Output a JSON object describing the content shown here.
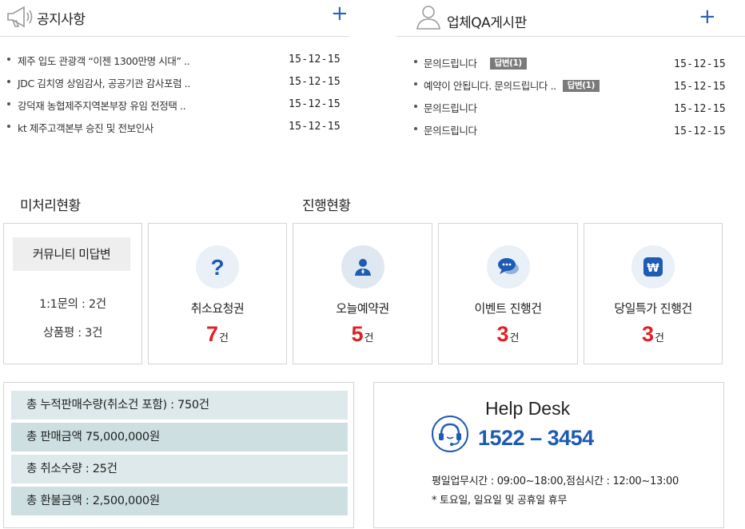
{
  "notice": {
    "title": "공지사항",
    "more_label": "+",
    "icon": "megaphone-icon",
    "items": [
      {
        "subject": "제주 입도 관광객 “이젠 1300만명 시대” ..",
        "date": "15-12-15"
      },
      {
        "subject": "JDC 김치영 상임감사, 공공기관 감사포럼 ..",
        "date": "15-12-15"
      },
      {
        "subject": "강덕재 농협제주지역본부장 유임 전정택 ..",
        "date": "15-12-15"
      },
      {
        "subject": "kt 제주고객본부 승진 및 전보인사",
        "date": "15-12-15"
      }
    ]
  },
  "qa": {
    "title": "업체QA게시판",
    "more_label": "+",
    "icon": "user-icon",
    "items": [
      {
        "subject": "문의드립니다",
        "badge": "답변(1)",
        "date": "15-12-15"
      },
      {
        "subject": "예약이 안됩니다. 문의드립니다 ..",
        "badge": "답변(1)",
        "date": "15-12-15"
      },
      {
        "subject": "문의드립니다",
        "badge": "",
        "date": "15-12-15"
      },
      {
        "subject": "문의드립니다",
        "badge": "",
        "date": "15-12-15"
      }
    ]
  },
  "unprocessed": {
    "title": "미처리현황",
    "community_label": "커뮤니티 미답변",
    "inquiry": "1:1문의 : 2건",
    "review": "상품평 : 3건"
  },
  "progress": {
    "title": "진행현황",
    "cards": [
      {
        "label": "취소요청권",
        "count": "7",
        "unit": "건",
        "icon": "question-icon"
      },
      {
        "label": "오늘예약권",
        "count": "5",
        "unit": "건",
        "icon": "person-icon"
      },
      {
        "label": "이벤트 진행건",
        "count": "3",
        "unit": "건",
        "icon": "chat-bubble-icon"
      },
      {
        "label": "당일특가 진행건",
        "count": "3",
        "unit": "건",
        "icon": "won-icon"
      }
    ]
  },
  "summary": {
    "rows": [
      "총 누적판매수량(취소건 포함) : 750건",
      "총 판매금액 75,000,000원",
      "총 취소수량 : 25건",
      "총 환불금액 : 2,500,000원"
    ]
  },
  "helpdesk": {
    "title": "Help Desk",
    "phone": "1522 – 3454",
    "hours": "평일업무시간 : 09:00~18:00,점심시간 : 12:00~13:00",
    "note": "* 토요일, 일요일 및 공휴일 휴무",
    "icon": "headset-icon"
  },
  "colors": {
    "accent_blue": "#2a62b8",
    "phone_blue": "#1d5bb4",
    "count_red": "#e12026",
    "badge_gray": "#7a7a7a",
    "summary_light": "#dde9ea",
    "summary_dark": "#cddfe1"
  }
}
